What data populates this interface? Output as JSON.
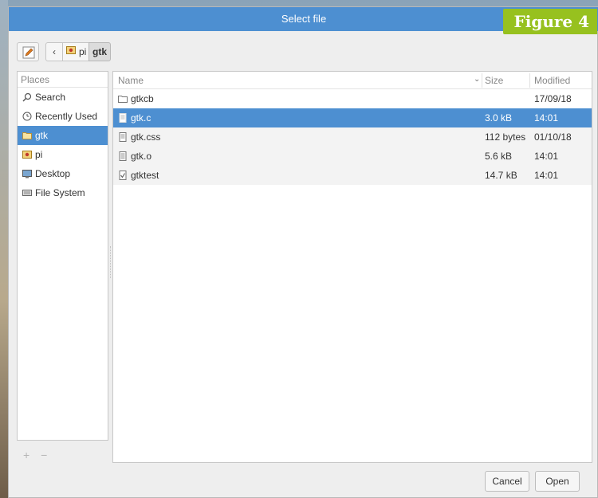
{
  "window": {
    "title": "Select file"
  },
  "figure_label": "Figure 4",
  "toolbar": {
    "back_glyph": "‹",
    "breadcrumb": [
      {
        "label": "pi",
        "icon": "home-folder-icon"
      },
      {
        "label": "gtk",
        "icon": null
      }
    ]
  },
  "places": {
    "header": "Places",
    "items": [
      {
        "label": "Search",
        "icon": "search-icon",
        "selected": false
      },
      {
        "label": "Recently Used",
        "icon": "clock-icon",
        "selected": false
      },
      {
        "label": "gtk",
        "icon": "folder-icon",
        "selected": true
      },
      {
        "label": "pi",
        "icon": "home-folder-icon",
        "selected": false
      },
      {
        "label": "Desktop",
        "icon": "desktop-icon",
        "selected": false
      },
      {
        "label": "File System",
        "icon": "drive-icon",
        "selected": false
      }
    ],
    "footer": {
      "add": "+",
      "remove": "−"
    }
  },
  "files": {
    "columns": {
      "name": "Name",
      "size": "Size",
      "modified": "Modified"
    },
    "sort_indicator": "⌄",
    "rows": [
      {
        "name": "gtkcb",
        "icon": "folder-icon",
        "size": "",
        "modified": "17/09/18",
        "selected": false
      },
      {
        "name": "gtk.c",
        "icon": "text-file-icon",
        "size": "3.0 kB",
        "modified": "14:01",
        "selected": true
      },
      {
        "name": "gtk.css",
        "icon": "text-file-icon",
        "size": "112 bytes",
        "modified": "01/10/18",
        "selected": false
      },
      {
        "name": "gtk.o",
        "icon": "binary-file-icon",
        "size": "5.6 kB",
        "modified": "14:01",
        "selected": false
      },
      {
        "name": "gtktest",
        "icon": "executable-file-icon",
        "size": "14.7 kB",
        "modified": "14:01",
        "selected": false
      }
    ]
  },
  "buttons": {
    "cancel": "Cancel",
    "open": "Open"
  },
  "colors": {
    "accent": "#4d8fd1",
    "figure_label_bg": "#97c11f"
  }
}
